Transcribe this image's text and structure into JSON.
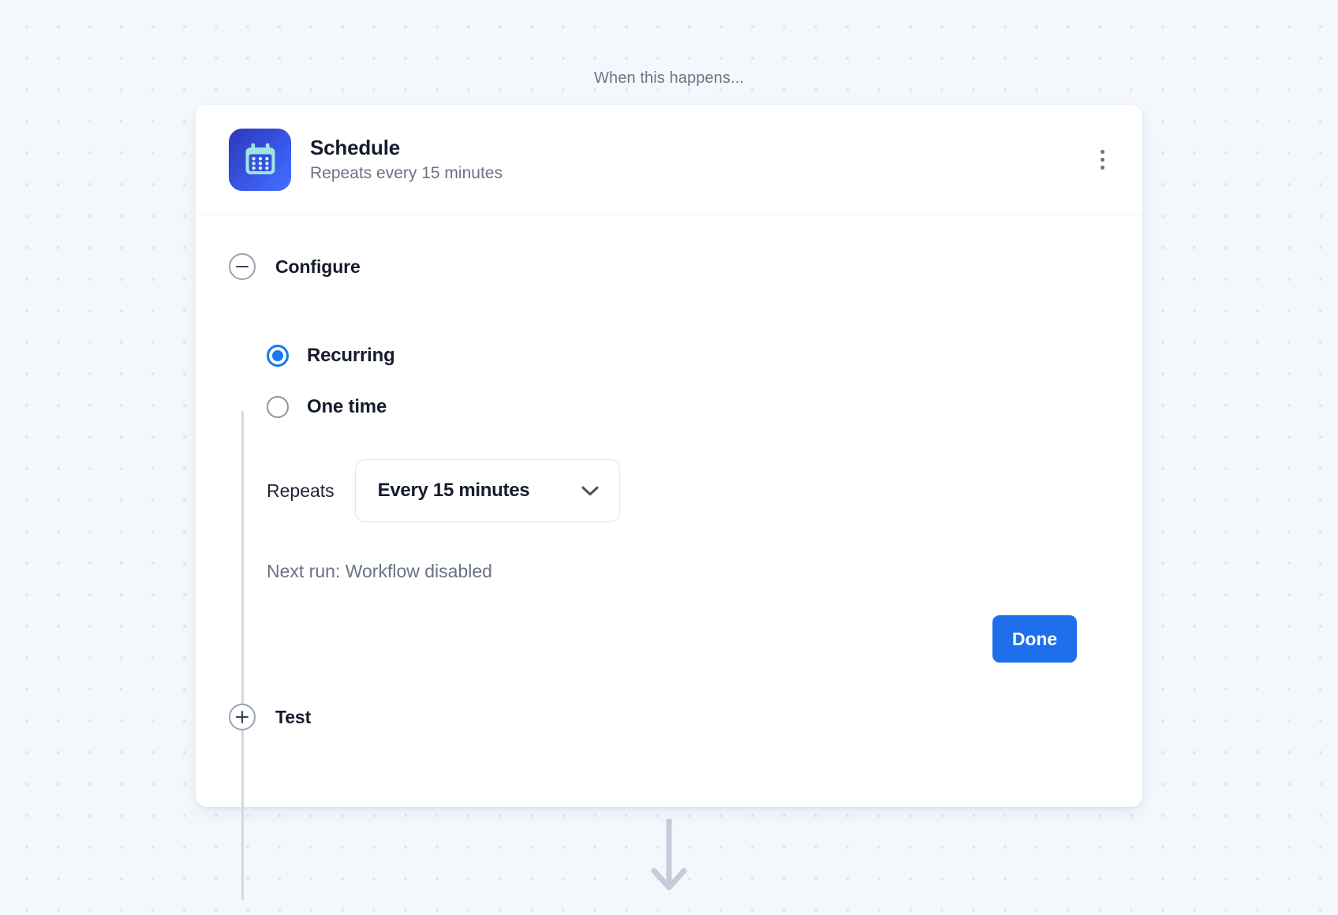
{
  "canvas": {
    "caption": "When this happens...",
    "background_color": "#f4f8fd",
    "dot_color": "#dde8f9"
  },
  "card": {
    "header": {
      "icon": "calendar-icon",
      "icon_gradient_from": "#2b39b8",
      "icon_gradient_to": "#4470fb",
      "title": "Schedule",
      "subtitle": "Repeats every 15 minutes",
      "menu_icon": "kebab-menu-icon"
    },
    "steps": [
      {
        "id": "configure",
        "label": "Configure",
        "toggle_icon": "minus-circle-icon",
        "expanded": true
      },
      {
        "id": "test",
        "label": "Test",
        "toggle_icon": "plus-circle-icon",
        "expanded": false
      }
    ],
    "configure": {
      "schedule_type_options": [
        {
          "label": "Recurring",
          "selected": true
        },
        {
          "label": "One time",
          "selected": false
        }
      ],
      "repeats": {
        "label": "Repeats",
        "selected_value": "Every 15 minutes",
        "chevron_icon": "chevron-down-icon"
      },
      "next_run": "Next run: Workflow disabled",
      "done_label": "Done",
      "accent_color": "#1f6fed"
    }
  },
  "flow": {
    "arrow_icon": "arrow-down-icon",
    "arrow_color": "#c3ccd8"
  }
}
